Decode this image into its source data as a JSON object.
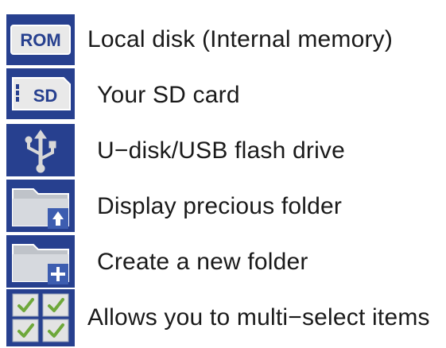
{
  "colors": {
    "icon_bg": "#27408f",
    "icon_bg_light": "#3d5db0",
    "folder_grey": "#cfcfcf",
    "check_green": "#6ea83a",
    "text": "#1a1a1a"
  },
  "items": [
    {
      "icon": "rom-icon",
      "badge": "ROM",
      "label": "Local disk (Internal memory)"
    },
    {
      "icon": "sd-card-icon",
      "badge": "SD",
      "label": "Your SD card"
    },
    {
      "icon": "usb-icon",
      "label": "U−disk/USB flash drive"
    },
    {
      "icon": "folder-up-icon",
      "label": "Display precious folder"
    },
    {
      "icon": "folder-new-icon",
      "label": "Create a new folder"
    },
    {
      "icon": "multi-select-icon",
      "label": "Allows you to multi−select items"
    }
  ]
}
